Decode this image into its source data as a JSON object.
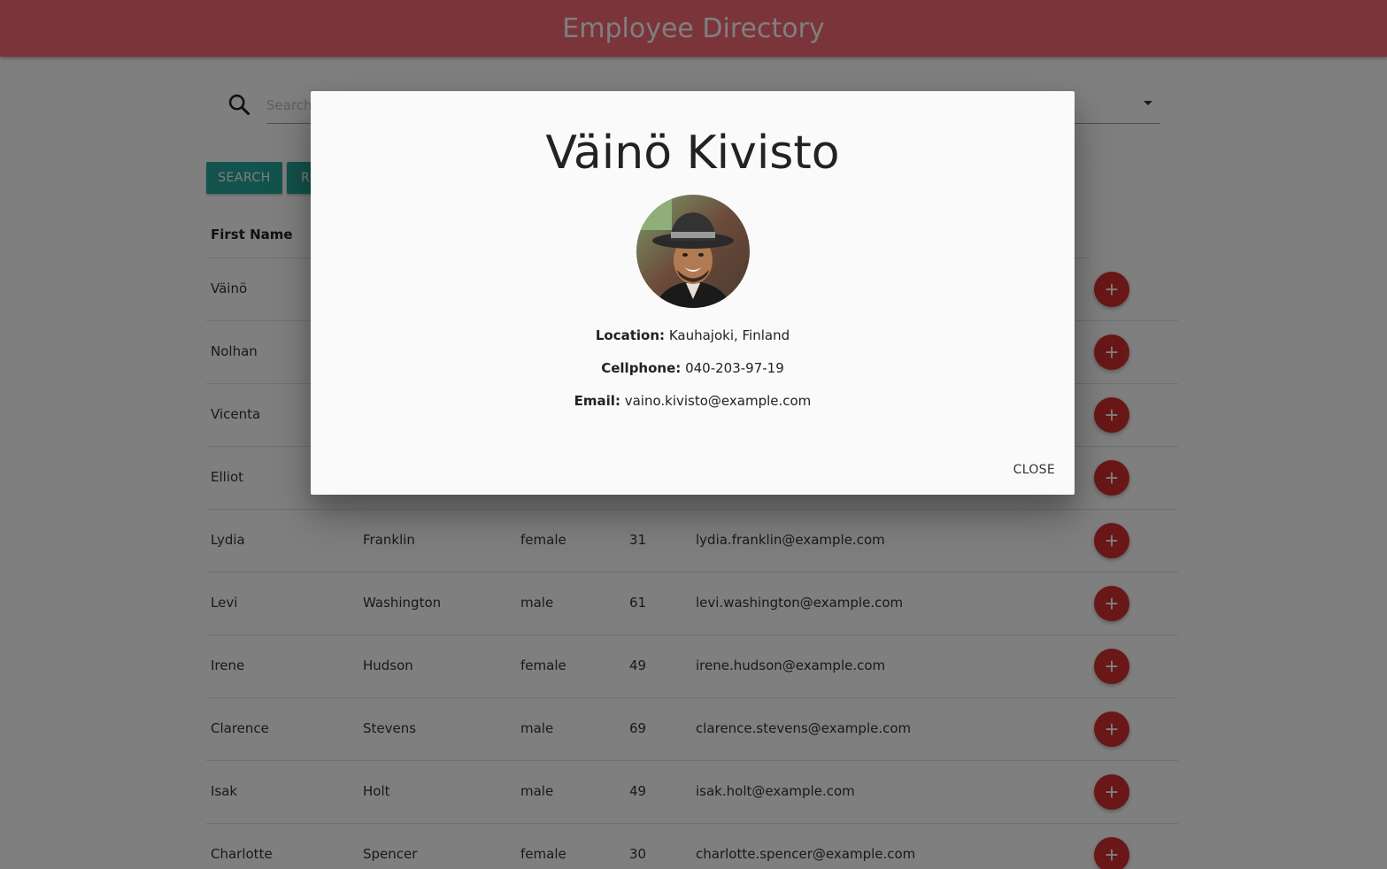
{
  "header": {
    "title": "Employee Directory"
  },
  "search": {
    "placeholder": "Search"
  },
  "buttons": {
    "search": "SEARCH",
    "reset": "R"
  },
  "table": {
    "header_first_name": "First Name",
    "rows": [
      {
        "first": "Väinö",
        "last": "",
        "gender": "",
        "age": "",
        "email": ""
      },
      {
        "first": "Nolhan",
        "last": "",
        "gender": "",
        "age": "",
        "email": ""
      },
      {
        "first": "Vicenta",
        "last": "",
        "gender": "",
        "age": "",
        "email": ""
      },
      {
        "first": "Elliot",
        "last": "",
        "gender": "",
        "age": "",
        "email": ""
      },
      {
        "first": "Lydia",
        "last": "Franklin",
        "gender": "female",
        "age": "31",
        "email": "lydia.franklin@example.com"
      },
      {
        "first": "Levi",
        "last": "Washington",
        "gender": "male",
        "age": "61",
        "email": "levi.washington@example.com"
      },
      {
        "first": "Irene",
        "last": "Hudson",
        "gender": "female",
        "age": "49",
        "email": "irene.hudson@example.com"
      },
      {
        "first": "Clarence",
        "last": "Stevens",
        "gender": "male",
        "age": "69",
        "email": "clarence.stevens@example.com"
      },
      {
        "first": "Isak",
        "last": "Holt",
        "gender": "male",
        "age": "49",
        "email": "isak.holt@example.com"
      },
      {
        "first": "Charlotte",
        "last": "Spencer",
        "gender": "female",
        "age": "30",
        "email": "charlotte.spencer@example.com"
      }
    ],
    "add_button_glyph": "+"
  },
  "modal": {
    "name": "Väinö Kivisto",
    "location_label": "Location:",
    "location": "Kauhajoki, Finland",
    "cellphone_label": "Cellphone:",
    "cellphone": "040-203-97-19",
    "email_label": "Email:",
    "email": "vaino.kivisto@example.com",
    "close_label": "CLOSE"
  },
  "colors": {
    "header_bg": "#f66a74",
    "button_teal": "#26a69a",
    "fab_red": "#d32f2f"
  },
  "icons": {
    "search": "search-icon",
    "dropdown": "caret-down-icon",
    "add": "plus-icon"
  }
}
